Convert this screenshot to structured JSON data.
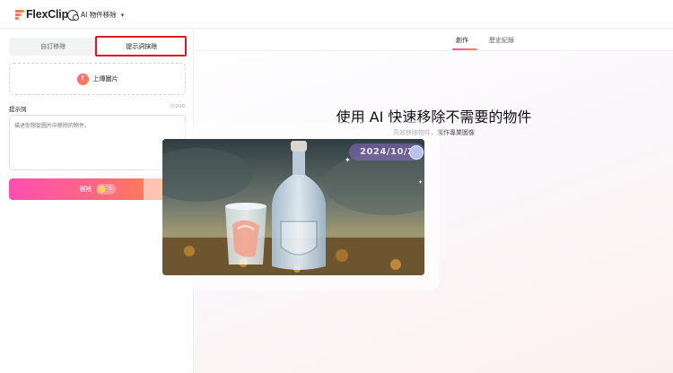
{
  "app": {
    "logo_text": "FlexClip",
    "tool_name": "AI 物件移除"
  },
  "left_panel": {
    "tabs": [
      {
        "label": "自訂移除",
        "active": false
      },
      {
        "label": "提示詞抹除",
        "active": true
      }
    ],
    "upload_label": "上傳圖片",
    "prompt_label": "提示詞",
    "prompt_count": "0/200",
    "prompt_placeholder": "描述你想從圖片中移除的物件。",
    "delete_label": "刪除",
    "delete_credits": "-5"
  },
  "main": {
    "tabs": [
      {
        "label": "創作",
        "active": true
      },
      {
        "label": "歷史紀錄",
        "active": false
      }
    ],
    "title": "使用 AI 快速移除不需要的物件",
    "subtitle": "高效移除物件，製作專業圖像",
    "preview": {
      "date_stamp": "2024/10/2"
    }
  },
  "colors": {
    "accent_start": "#ff4fb3",
    "accent_end": "#ff8a3a",
    "highlight": "#e0161d"
  },
  "icons": {
    "upload": "upload-arrow-icon",
    "credit": "coin-icon",
    "tool": "object-remove-icon",
    "dropdown": "chevron-down-icon"
  }
}
